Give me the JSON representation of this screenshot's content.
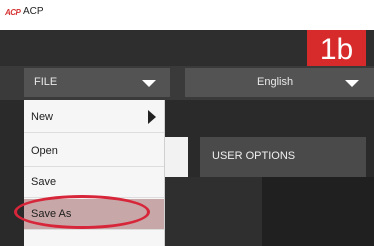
{
  "app": {
    "logo_text": "ACP",
    "title": "ACP"
  },
  "step_badge": "1b",
  "toolbar": {
    "file_label": "FILE",
    "language_label": "English"
  },
  "file_menu": {
    "items": [
      {
        "label": "New",
        "has_submenu": true
      },
      {
        "label": "Open"
      },
      {
        "label": "Save"
      },
      {
        "label": "Save As",
        "highlighted": true
      }
    ]
  },
  "tabs": {
    "user_options": "USER OPTIONS"
  },
  "colors": {
    "accent_red": "#d72b2b",
    "highlight_ring": "#d7263a"
  }
}
